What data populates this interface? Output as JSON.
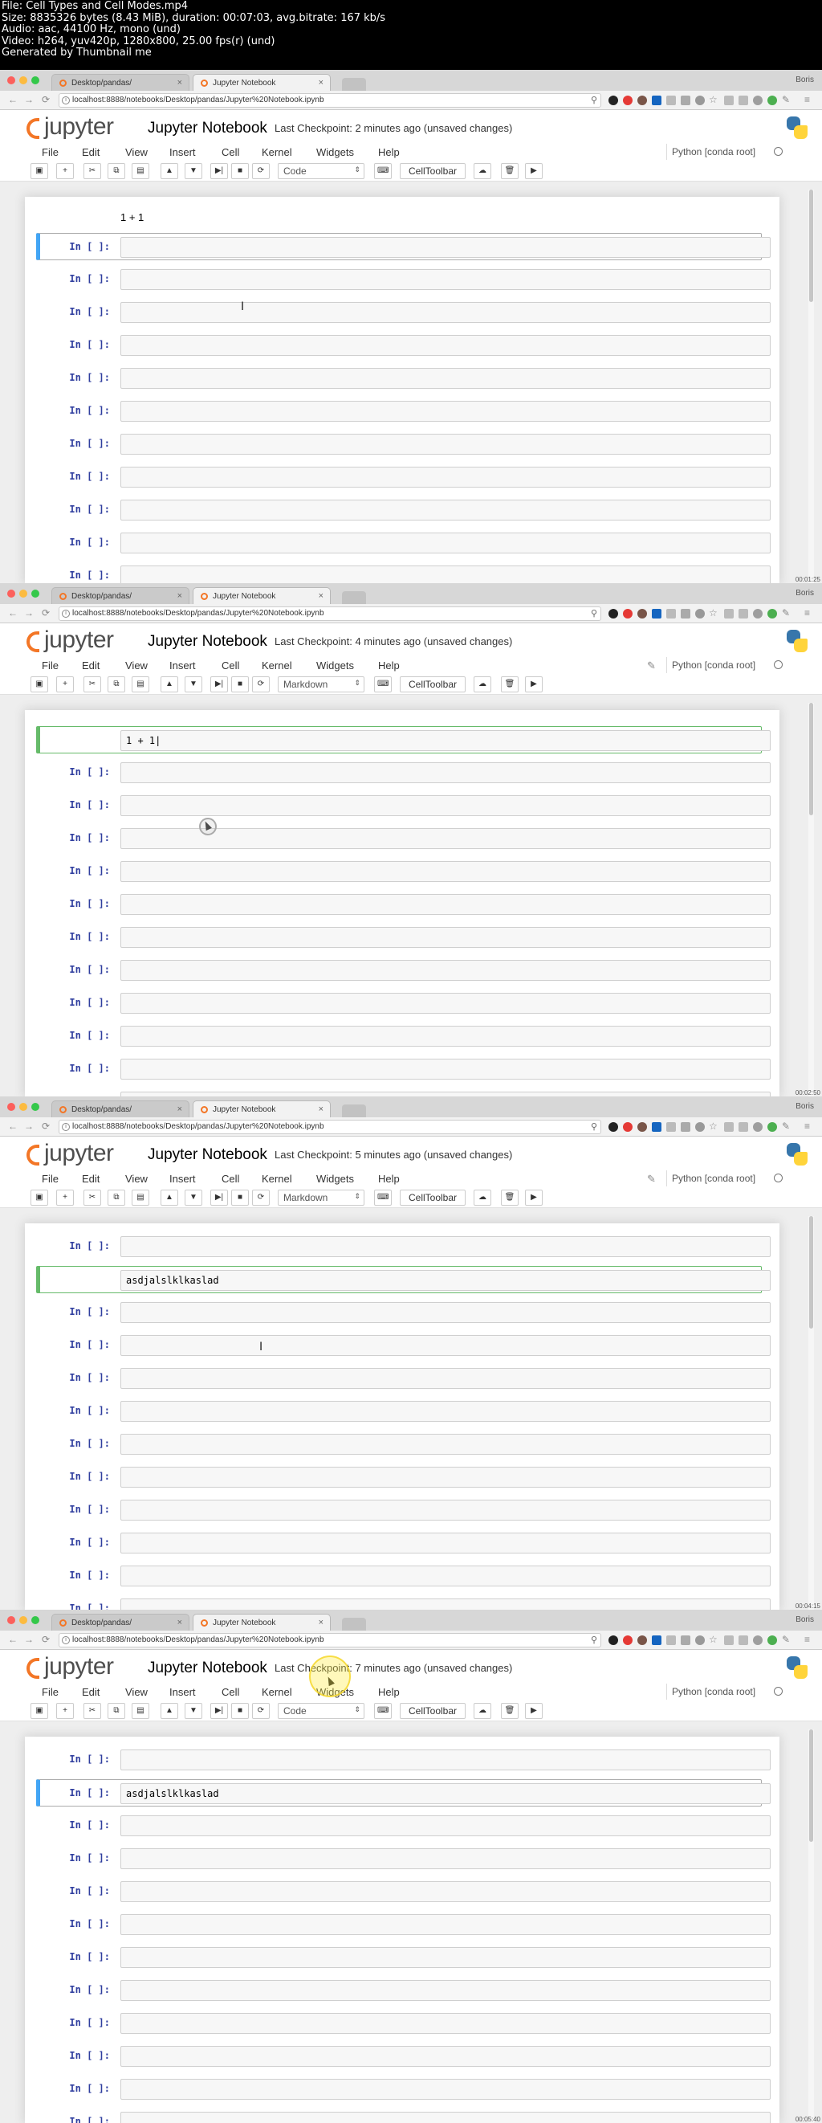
{
  "file_info": [
    "File: Cell Types and Cell Modes.mp4",
    "Size: 8835326 bytes (8.43 MiB), duration: 00:07:03, avg.bitrate: 167 kb/s",
    "Audio: aac, 44100 Hz, mono (und)",
    "Video: h264, yuv420p, 1280x800, 25.00 fps(r) (und)",
    "Generated by Thumbnail me"
  ],
  "browser": {
    "tab1": "Desktop/pandas/",
    "tab2": "Jupyter Notebook",
    "profile": "Boris",
    "url": "localhost:8888/notebooks/Desktop/pandas/Jupyter%20Notebook.ipynb"
  },
  "notebook": {
    "logo_text": "jupyter",
    "name": "Jupyter Notebook",
    "checkpoint_label": "Last Checkpoint:",
    "kernel": "Python [conda root]",
    "menu": [
      "File",
      "Edit",
      "View",
      "Insert",
      "Cell",
      "Kernel",
      "Widgets",
      "Help"
    ],
    "celltoolbar": "CellToolbar",
    "prompt": "In [ ]:"
  },
  "frames": [
    {
      "checkpoint": "2 minutes ago (unsaved changes)",
      "cell_type": "Code",
      "timestamp": "00:01:25",
      "first_text": "1 + 1",
      "cell_text": "",
      "show_pencil": false
    },
    {
      "checkpoint": "4 minutes ago (unsaved changes)",
      "cell_type": "Markdown",
      "timestamp": "00:02:50",
      "first_text": "",
      "cell_text": "1 + 1|",
      "show_pencil": true
    },
    {
      "checkpoint": "5 minutes ago (unsaved changes)",
      "cell_type": "Markdown",
      "timestamp": "00:04:15",
      "first_text": "",
      "cell_text": "asdjalslklkaslad",
      "show_pencil": true
    },
    {
      "checkpoint": "7 minutes ago (unsaved changes)",
      "cell_type": "Code",
      "timestamp": "00:05:40",
      "first_text": "",
      "cell_text": "asdjalslklkaslad",
      "show_pencil": false
    }
  ]
}
